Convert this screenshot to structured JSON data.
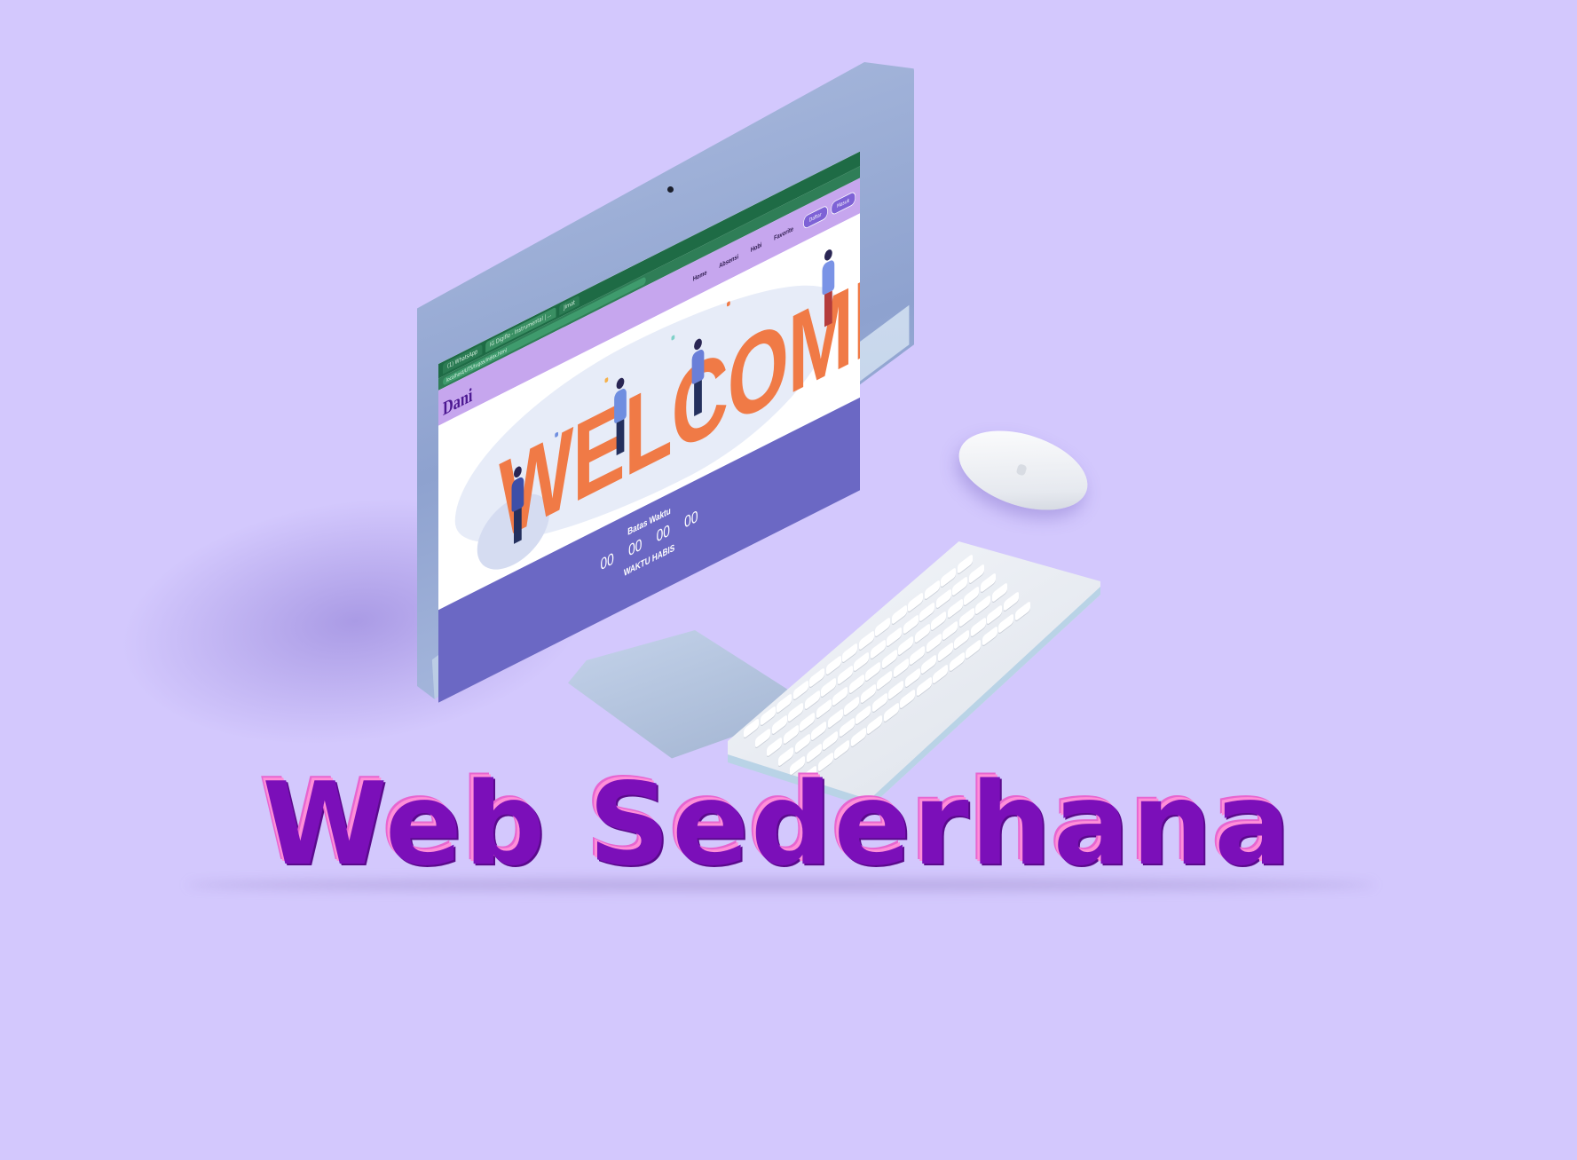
{
  "headline": "Web Sederhana",
  "browser": {
    "tabs": [
      "(1) WhatsApp",
      "IG Digiflo - Instrumental | ...",
      "Jimat"
    ],
    "url": "localhost/UTS/tugas/index.html"
  },
  "site": {
    "brand": "Dani",
    "nav_links": [
      "Home",
      "Absensi",
      "Hobi",
      "Favorite"
    ],
    "nav_buttons": [
      "Daftar",
      "Masuk"
    ],
    "hero_text": "WELCOME",
    "countdown": {
      "title": "Batas Waktu",
      "values": [
        "00",
        "00",
        "00",
        "00"
      ],
      "status": "WAKTU HABIS"
    }
  },
  "colors": {
    "background": "#d3c8fd",
    "headline": "#7b0fb9",
    "headline_highlight": "#ff8ed8",
    "nav_bar": "#c6a6ee",
    "footer_band": "#6b68c4",
    "welcome": "#f07a46",
    "browser_chrome": "#1e6b45"
  },
  "icons": [
    "mouse-icon",
    "keyboard-icon",
    "monitor-icon",
    "windows-start-icon"
  ]
}
